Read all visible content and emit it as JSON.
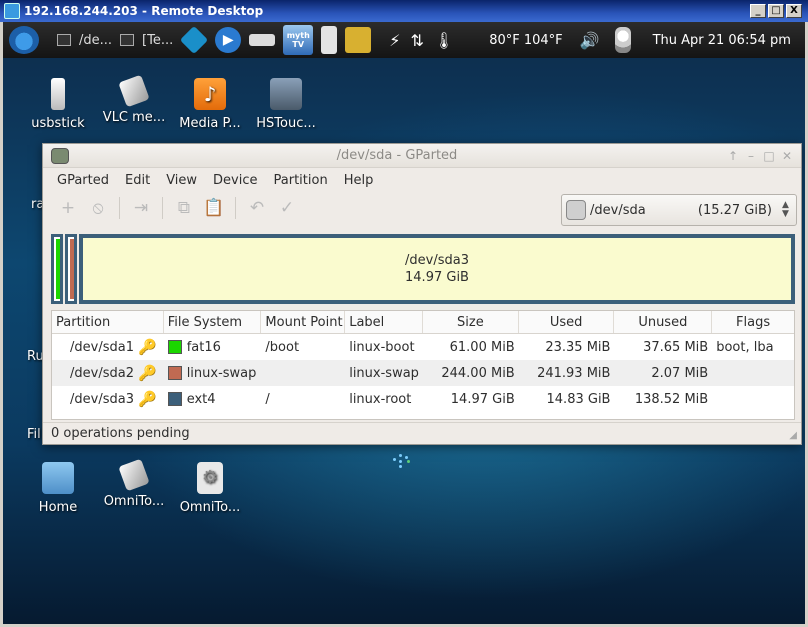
{
  "rdp": {
    "title": "192.168.244.203 - Remote Desktop",
    "controls": [
      "_",
      "□",
      "X"
    ]
  },
  "panel": {
    "tasks": [
      {
        "label": "/de...",
        "icon": "terminal-window-icon"
      },
      {
        "label": "[Te...",
        "icon": "terminal-icon"
      }
    ],
    "launchers": [
      "kodi-icon",
      "play-icon",
      "remote-icon",
      "mythtv-icon",
      "ruler-icon",
      "yellow-app-icon"
    ],
    "mythtv_label": "myth TV",
    "indicators": [
      "power-plug-icon",
      "network-arrows-icon",
      "thermometer-icon"
    ],
    "temps": "80°F 104°F",
    "volume_icon": "speaker-icon",
    "bulb_icon": "lightbulb-icon",
    "clock": "Thu  Apr 21 06:54 pm"
  },
  "desktop": {
    "icons_top": [
      {
        "label": "usbstick",
        "icon": "usb-drive-icon"
      },
      {
        "label": "VLC me...",
        "icon": "disc-icon"
      },
      {
        "label": "Media P...",
        "icon": "music-note-icon"
      },
      {
        "label": "HSTouc...",
        "icon": "settings-app-icon"
      }
    ],
    "icons_bottom": [
      {
        "label": "Home",
        "icon": "home-folder-icon"
      },
      {
        "label": "OmniTo...",
        "icon": "disc-icon"
      },
      {
        "label": "OmniTo...",
        "icon": "gear-icon"
      }
    ],
    "side_labels": [
      "ra",
      "Ru",
      "Fil"
    ]
  },
  "gparted": {
    "title": "/dev/sda - GParted",
    "window_controls": [
      "↑",
      "–",
      "□",
      "✕"
    ],
    "menu": [
      "GParted",
      "Edit",
      "View",
      "Device",
      "Partition",
      "Help"
    ],
    "toolbar": [
      {
        "name": "new-partition-icon",
        "glyph": "+"
      },
      {
        "name": "delete-partition-icon",
        "glyph": "⦸"
      },
      {
        "name": "resize-move-icon",
        "glyph": "⇥"
      },
      {
        "name": "copy-icon",
        "glyph": "⧉"
      },
      {
        "name": "paste-icon",
        "glyph": "📋"
      },
      {
        "name": "undo-icon",
        "glyph": "↶"
      },
      {
        "name": "apply-icon",
        "glyph": "✓"
      }
    ],
    "device": {
      "name": "/dev/sda",
      "size": "(15.27 GiB)"
    },
    "map_main": {
      "name": "/dev/sda3",
      "size": "14.97 GiB"
    },
    "columns": [
      "Partition",
      "File System",
      "Mount Point",
      "Label",
      "Size",
      "Used",
      "Unused",
      "Flags"
    ],
    "rows": [
      {
        "partition": "/dev/sda1",
        "fs": "fat16",
        "color": "#1bd600",
        "mount": "/boot",
        "label": "linux-boot",
        "size": "61.00 MiB",
        "used": "23.35 MiB",
        "unused": "37.65 MiB",
        "flags": "boot, lba"
      },
      {
        "partition": "/dev/sda2",
        "fs": "linux-swap",
        "color": "#c06a52",
        "mount": "",
        "label": "linux-swap",
        "size": "244.00 MiB",
        "used": "241.93 MiB",
        "unused": "2.07 MiB",
        "flags": ""
      },
      {
        "partition": "/dev/sda3",
        "fs": "ext4",
        "color": "#3c5f7a",
        "mount": "/",
        "label": "linux-root",
        "size": "14.97 GiB",
        "used": "14.83 GiB",
        "unused": "138.52 MiB",
        "flags": ""
      }
    ],
    "status": "0 operations pending"
  }
}
